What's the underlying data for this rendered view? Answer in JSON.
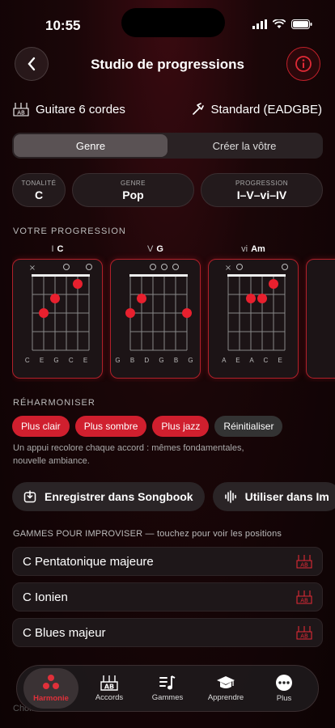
{
  "status": {
    "time": "10:55"
  },
  "header": {
    "title": "Studio de progressions"
  },
  "instrument": {
    "name": "Guitare 6 cordes",
    "tuning": "Standard (EADGBE)"
  },
  "segment": {
    "genre": "Genre",
    "custom": "Créer la vôtre"
  },
  "pills": {
    "key_label": "TONALITÉ",
    "key_value": "C",
    "genre_label": "GENRE",
    "genre_value": "Pop",
    "prog_label": "PROGRESSION",
    "prog_value": "I–V–vi–IV"
  },
  "progression_label": "VOTRE PROGRESSION",
  "chords": [
    {
      "degree": "I",
      "name": "C",
      "notes": "C E G C E"
    },
    {
      "degree": "V",
      "name": "G",
      "notes": "G B D G B G"
    },
    {
      "degree": "vi",
      "name": "Am",
      "notes": "A E A C E"
    }
  ],
  "reharm": {
    "label": "RÉHARMONISER",
    "brighter": "Plus clair",
    "darker": "Plus sombre",
    "jazzier": "Plus jazz",
    "reset": "Réinitialiser",
    "note": "Un appui recolore chaque accord : mêmes fondamentales, nouvelle ambiance."
  },
  "actions": {
    "save": "Enregistrer dans Songbook",
    "use": "Utiliser dans Im"
  },
  "scales": {
    "label": "GAMMES POUR IMPROVISER — touchez pour voir les positions",
    "items": [
      "C Pentatonique majeure",
      "C Ionien",
      "C Blues majeur"
    ]
  },
  "tabs": [
    "Harmonie",
    "Accords",
    "Gammes",
    "Apprendre",
    "Plus"
  ],
  "bottom_hint": "Choi...",
  "colors": {
    "accent": "#d01f2e",
    "background": "#1a0608"
  }
}
